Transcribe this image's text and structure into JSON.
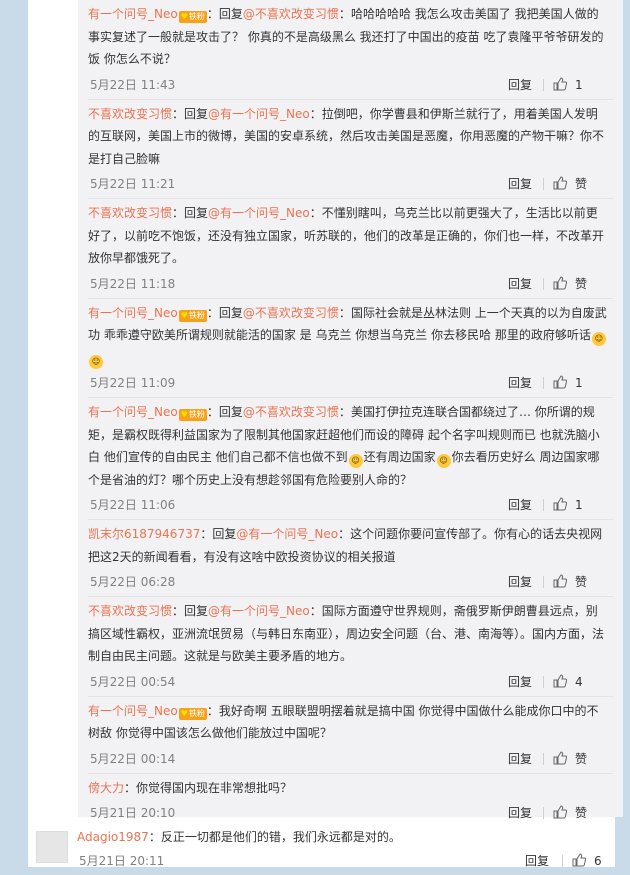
{
  "replies": [
    {
      "author": "有一个问号_Neo",
      "has_badge": true,
      "reply_to": "@不喜欢改变习惯",
      "text": "哈哈哈哈哈 我怎么攻击美国了 我把美国人做的事实复述了一般就是攻击了？ 你真的不是高级黑么 我还打了中国出的疫苗 吃了袁隆平爷爷研发的饭 你怎么不说？",
      "time": "5月22日 11:43",
      "likes": "1"
    },
    {
      "author": "不喜欢改变习惯",
      "has_badge": false,
      "reply_to": "@有一个问号_Neo",
      "text": "拉倒吧，你学曹县和伊斯兰就行了，用着美国人发明的互联网，美国上市的微博，美国的安卓系统，然后攻击美国是恶魔，你用恶魔的产物干嘛？你不是打自己脸嘛",
      "time": "5月22日 11:21",
      "likes": "赞"
    },
    {
      "author": "不喜欢改变习惯",
      "has_badge": false,
      "reply_to": "@有一个问号_Neo",
      "text": "不懂别瞎叫，乌克兰比以前更强大了，生活比以前更好了，以前吃不饱饭，还没有独立国家，听苏联的，他们的改革是正确的，你们也一样，不改革开放你早都饿死了。",
      "time": "5月22日 11:18",
      "likes": "赞"
    },
    {
      "author": "有一个问号_Neo",
      "has_badge": true,
      "reply_to": "@不喜欢改变习惯",
      "text": "国际社会就是丛林法则 上一个天真的以为自废武功 乖乖遵守欧美所谓规则就能活的国家 是 乌克兰 你想当乌克兰 你去移民哈 那里的政府够听话",
      "emoji_after": 2,
      "time": "5月22日 11:09",
      "likes": "1"
    },
    {
      "author": "有一个问号_Neo",
      "has_badge": true,
      "reply_to": "@不喜欢改变习惯",
      "text": "美国打伊拉克连联合国都绕过了… 你所谓的规矩，是霸权既得利益国家为了限制其他国家赶超他们而设的障碍 起个名字叫规则而已 也就洗脑小白 他们宣传的自由民主 他们自己都不信也做不到",
      "text2": "还有周边国家",
      "text3": "你去看历史好么 周边国家哪个是省油的灯？哪个历史上没有想趁邻国有危险要别人命的？",
      "time": "5月22日 11:06",
      "likes": "1"
    },
    {
      "author": "凯末尔6187946737",
      "has_badge": false,
      "reply_to": "@有一个问号_Neo",
      "text": "这个问题你要问宣传部了。你有心的话去央视网把这2天的新闻看看，有没有这啥中欧投资协议的相关报道",
      "time": "5月22日 06:28",
      "likes": "赞"
    },
    {
      "author": "不喜欢改变习惯",
      "has_badge": false,
      "reply_to": "@有一个问号_Neo",
      "text": "国际方面遵守世界规则，斋俄罗斯伊朗曹县远点，别搞区域性霸权，亚洲流氓贸易（与韩日东南亚），周边安全问题（台、港、南海等）。国内方面，法制自由民主问题。这就是与欧美主要矛盾的地方。",
      "time": "5月22日 00:54",
      "likes": "4"
    },
    {
      "author": "有一个问号_Neo",
      "has_badge": true,
      "reply_to": "",
      "text": "我好奇啊 五眼联盟明摆着就是搞中国 你觉得中国做什么能成你口中的不树敌 你觉得中国该怎么做他们能放过中国呢？",
      "time": "5月22日 00:14",
      "likes": "赞"
    },
    {
      "author": "傍大力",
      "has_badge": false,
      "reply_to": "",
      "text": "你觉得国内现在非常想批吗？",
      "time": "5月21日 20:10",
      "likes": "赞"
    }
  ],
  "labels": {
    "reply": "回复",
    "reply_prefix": "回复",
    "badge": "铁粉"
  },
  "bottom_comment": {
    "author": "Adagio1987",
    "text": "反正一切都是他们的错，我们永远都是对的。",
    "time": "5月21日 20:11",
    "likes": "6"
  },
  "colors": {
    "username": "#eb7350",
    "badge": "#f7a11a",
    "background": "#c9dbe9"
  }
}
